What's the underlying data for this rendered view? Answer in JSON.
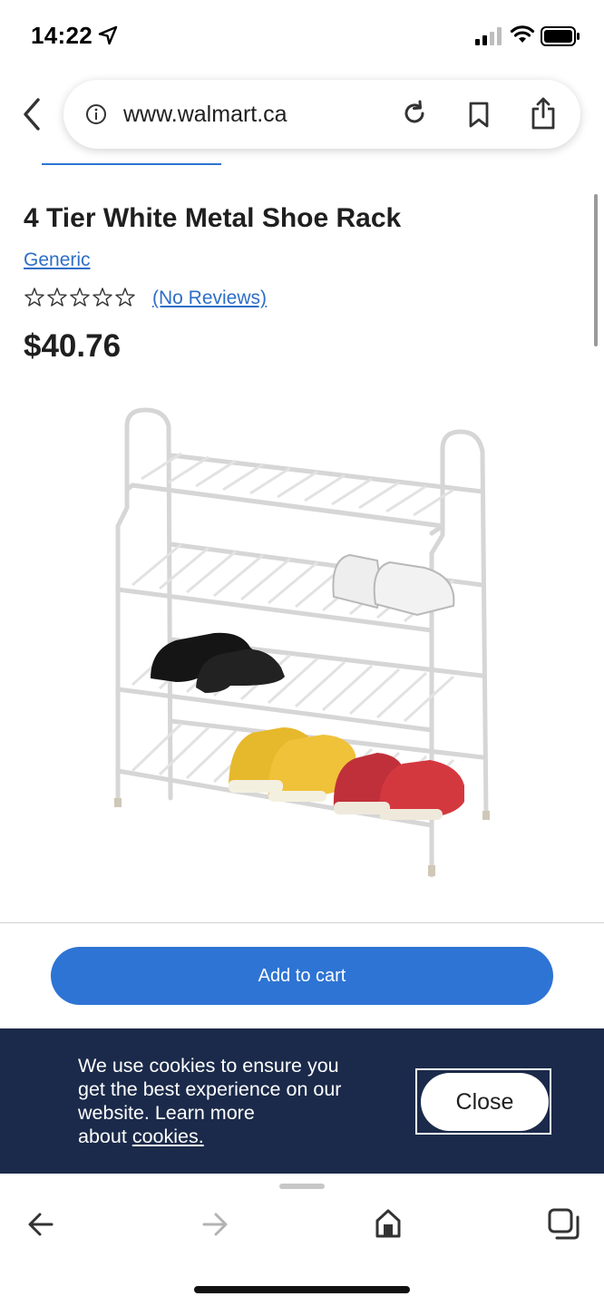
{
  "status_bar": {
    "time": "14:22"
  },
  "browser": {
    "url": "www.walmart.ca",
    "icons": [
      "back-chevron-icon",
      "info-icon",
      "reload-icon",
      "bookmark-icon",
      "share-icon"
    ]
  },
  "product": {
    "title": "4 Tier White Metal Shoe Rack",
    "brand": "Generic",
    "rating_stars": 0,
    "rating_max": 5,
    "reviews_label": "(No Reviews)",
    "price": "$40.76",
    "add_to_cart_label": "Add to cart"
  },
  "cookie_banner": {
    "message": "We use cookies to ensure you get the best experience on our website. Learn more about",
    "link_text": "cookies.",
    "close_label": "Close"
  },
  "toolbar": {
    "icons": [
      "back-arrow-icon",
      "forward-arrow-icon",
      "home-icon",
      "tabs-icon"
    ]
  },
  "colors": {
    "accent": "#2e74d4",
    "link": "#2e6ec6",
    "banner": "#1b2a4a"
  }
}
